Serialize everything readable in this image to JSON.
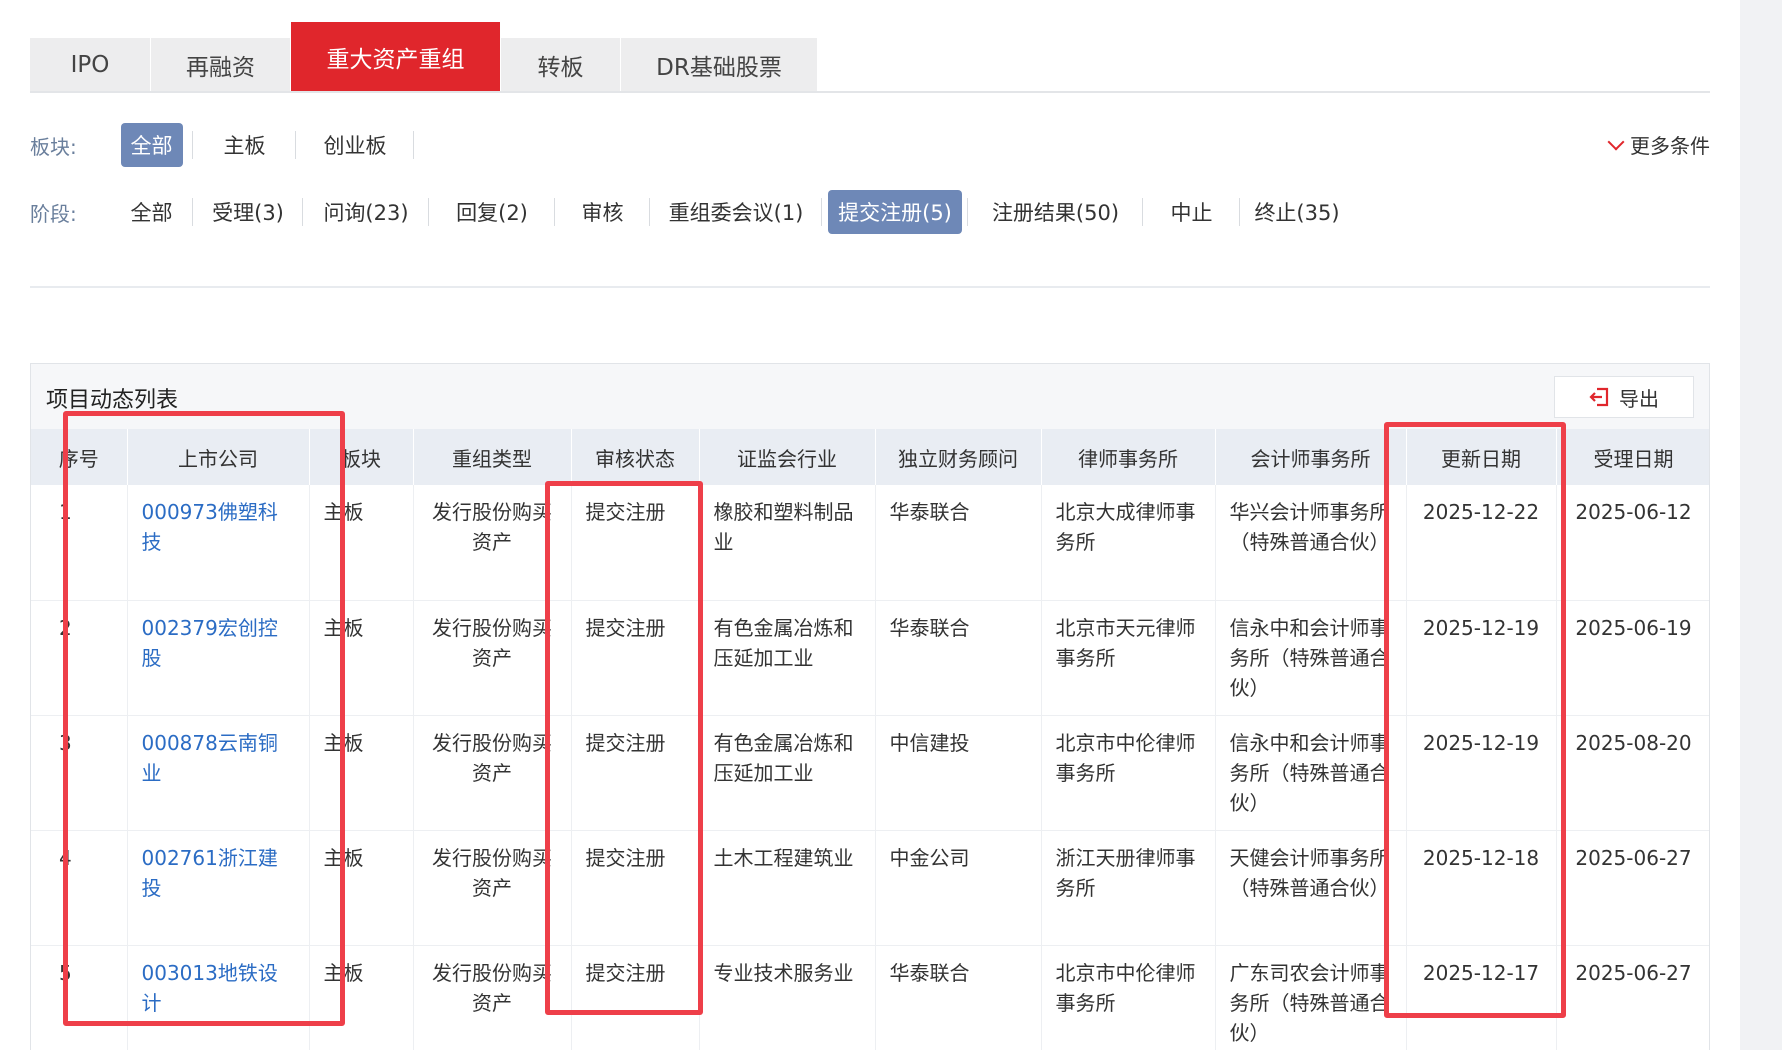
{
  "tabs": [
    {
      "label": "IPO",
      "active": false
    },
    {
      "label": "再融资",
      "active": false
    },
    {
      "label": "重大资产重组",
      "active": true
    },
    {
      "label": "转板",
      "active": false
    },
    {
      "label": "DR基础股票",
      "active": false
    }
  ],
  "board_filter": {
    "label": "板块:",
    "options": [
      "全部",
      "主板",
      "创业板"
    ],
    "active": "全部"
  },
  "more_conditions": "更多条件",
  "stage_filter": {
    "label": "阶段:",
    "options": [
      "全部",
      "受理(3)",
      "问询(23)",
      "回复(2)",
      "审核",
      "重组委会议(1)",
      "提交注册(5)",
      "注册结果(50)",
      "中止",
      "终止(35)"
    ],
    "active": "提交注册(5)"
  },
  "list": {
    "title": "项目动态列表",
    "export_label": "导出",
    "columns": [
      "序号",
      "上市公司",
      "板块",
      "重组类型",
      "审核状态",
      "证监会行业",
      "独立财务顾问",
      "律师事务所",
      "会计师事务所",
      "更新日期",
      "受理日期"
    ],
    "rows": [
      [
        "1",
        "000973佛塑科技",
        "主板",
        "发行股份购买资产",
        "提交注册",
        "橡胶和塑料制品业",
        "华泰联合",
        "北京大成律师事务所",
        "华兴会计师事务所（特殊普通合伙）",
        "2025-12-22",
        "2025-06-12"
      ],
      [
        "2",
        "002379宏创控股",
        "主板",
        "发行股份购买资产",
        "提交注册",
        "有色金属冶炼和压延加工业",
        "华泰联合",
        "北京市天元律师事务所",
        "信永中和会计师事务所（特殊普通合伙）",
        "2025-12-19",
        "2025-06-19"
      ],
      [
        "3",
        "000878云南铜业",
        "主板",
        "发行股份购买资产",
        "提交注册",
        "有色金属冶炼和压延加工业",
        "中信建投",
        "北京市中伦律师事务所",
        "信永中和会计师事务所（特殊普通合伙）",
        "2025-12-19",
        "2025-08-20"
      ],
      [
        "4",
        "002761浙江建投",
        "主板",
        "发行股份购买资产",
        "提交注册",
        "土木工程建筑业",
        "中金公司",
        "浙江天册律师事务所",
        "天健会计师事务所（特殊普通合伙）",
        "2025-12-18",
        "2025-06-27"
      ],
      [
        "5",
        "003013地铁设计",
        "主板",
        "发行股份购买资产",
        "提交注册",
        "专业技术服务业",
        "华泰联合",
        "北京市中伦律师事务所",
        "广东司农会计师事务所（特殊普通合伙）",
        "2025-12-17",
        "2025-06-27"
      ]
    ]
  },
  "colors": {
    "accent_red": "#e0262c",
    "active_pill": "#6e88b7",
    "link": "#2b6cc4",
    "highlight": "#ee3f49"
  }
}
